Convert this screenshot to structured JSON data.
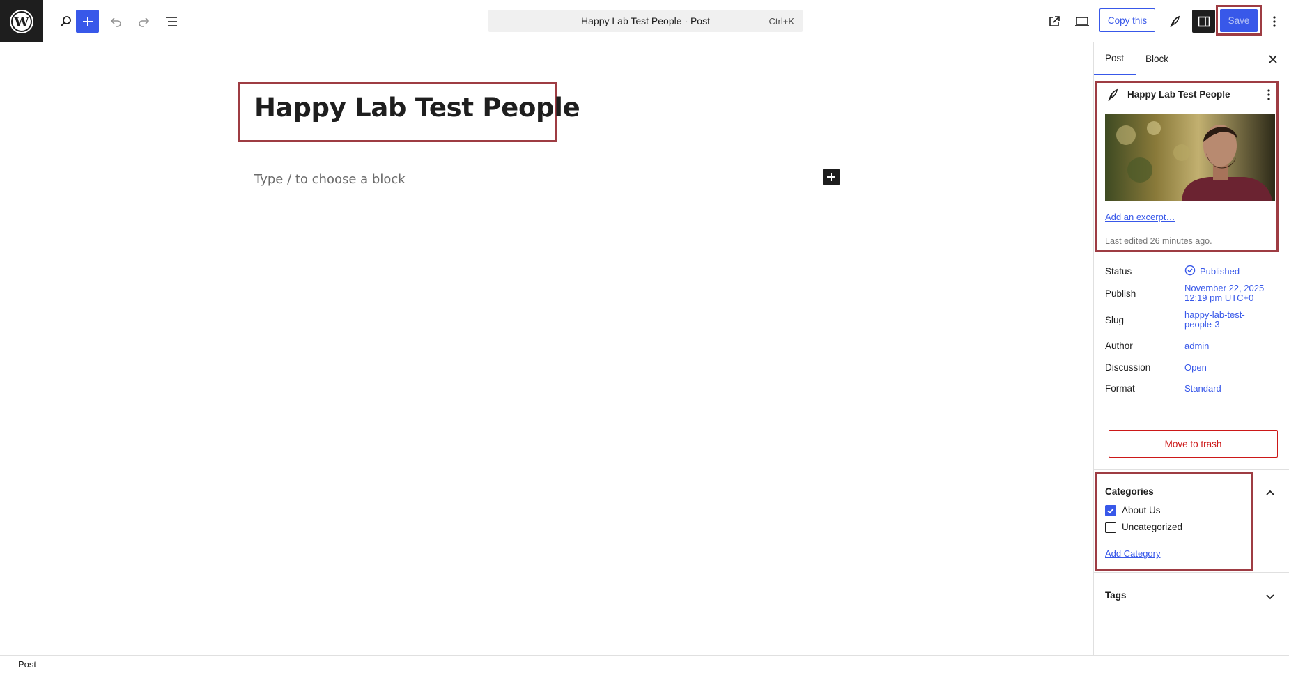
{
  "topbar": {
    "document_title": "Happy Lab Test People · Post",
    "shortcut": "Ctrl+K",
    "copy_label": "Copy this",
    "save_label": "Save"
  },
  "editor": {
    "post_title": "Happy Lab Test People",
    "block_placeholder": "Type / to choose a block"
  },
  "sidebar": {
    "tabs": [
      {
        "label": "Post",
        "active": true
      },
      {
        "label": "Block",
        "active": false
      }
    ],
    "summary": {
      "title": "Happy Lab Test People",
      "excerpt_link": "Add an excerpt…",
      "last_edited": "Last edited 26 minutes ago."
    },
    "meta": {
      "status": {
        "label": "Status",
        "value": "Published"
      },
      "publish": {
        "label": "Publish",
        "value_line1": "November 22, 2025",
        "value_line2": "12:19 pm UTC+0"
      },
      "slug": {
        "label": "Slug",
        "value_line1": "happy-lab-test-",
        "value_line2": "people-3"
      },
      "author": {
        "label": "Author",
        "value": "admin"
      },
      "discussion": {
        "label": "Discussion",
        "value": "Open"
      },
      "format": {
        "label": "Format",
        "value": "Standard"
      }
    },
    "trash_label": "Move to trash",
    "categories": {
      "title": "Categories",
      "items": [
        {
          "label": "About Us",
          "checked": true
        },
        {
          "label": "Uncategorized",
          "checked": false
        }
      ],
      "add_label": "Add Category"
    },
    "tags": {
      "title": "Tags"
    }
  },
  "footer": {
    "breadcrumb": "Post"
  },
  "colors": {
    "accent": "#3858e9",
    "highlight_border": "#9e3c43",
    "danger": "#cc1818"
  }
}
